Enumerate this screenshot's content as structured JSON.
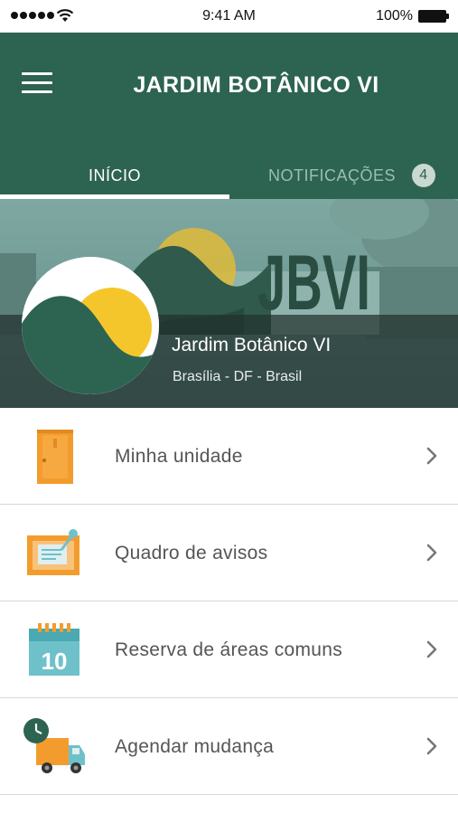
{
  "status_bar": {
    "time": "9:41 AM",
    "battery_percent": "100%"
  },
  "header": {
    "title": "JARDIM BOTÂNICO VI",
    "background_color": "#2d6351"
  },
  "tabs": [
    {
      "label": "INÍCIO",
      "active": true
    },
    {
      "label": "NOTIFICAÇÕES",
      "active": false,
      "badge": "4"
    }
  ],
  "banner": {
    "logo_text": "JBVI",
    "name": "Jardim Botânico VI",
    "location": "Brasília - DF - Brasil"
  },
  "menu": [
    {
      "label": "Minha unidade",
      "icon": "door-icon"
    },
    {
      "label": "Quadro de avisos",
      "icon": "notice-board-icon"
    },
    {
      "label": "Reserva de áreas comuns",
      "icon": "calendar-icon",
      "icon_text": "10"
    },
    {
      "label": "Agendar mudança",
      "icon": "moving-truck-icon"
    }
  ],
  "colors": {
    "primary": "#2d6351",
    "accent_yellow": "#f5c62b",
    "icon_orange": "#f39c2d",
    "icon_teal": "#6ec1c9"
  }
}
